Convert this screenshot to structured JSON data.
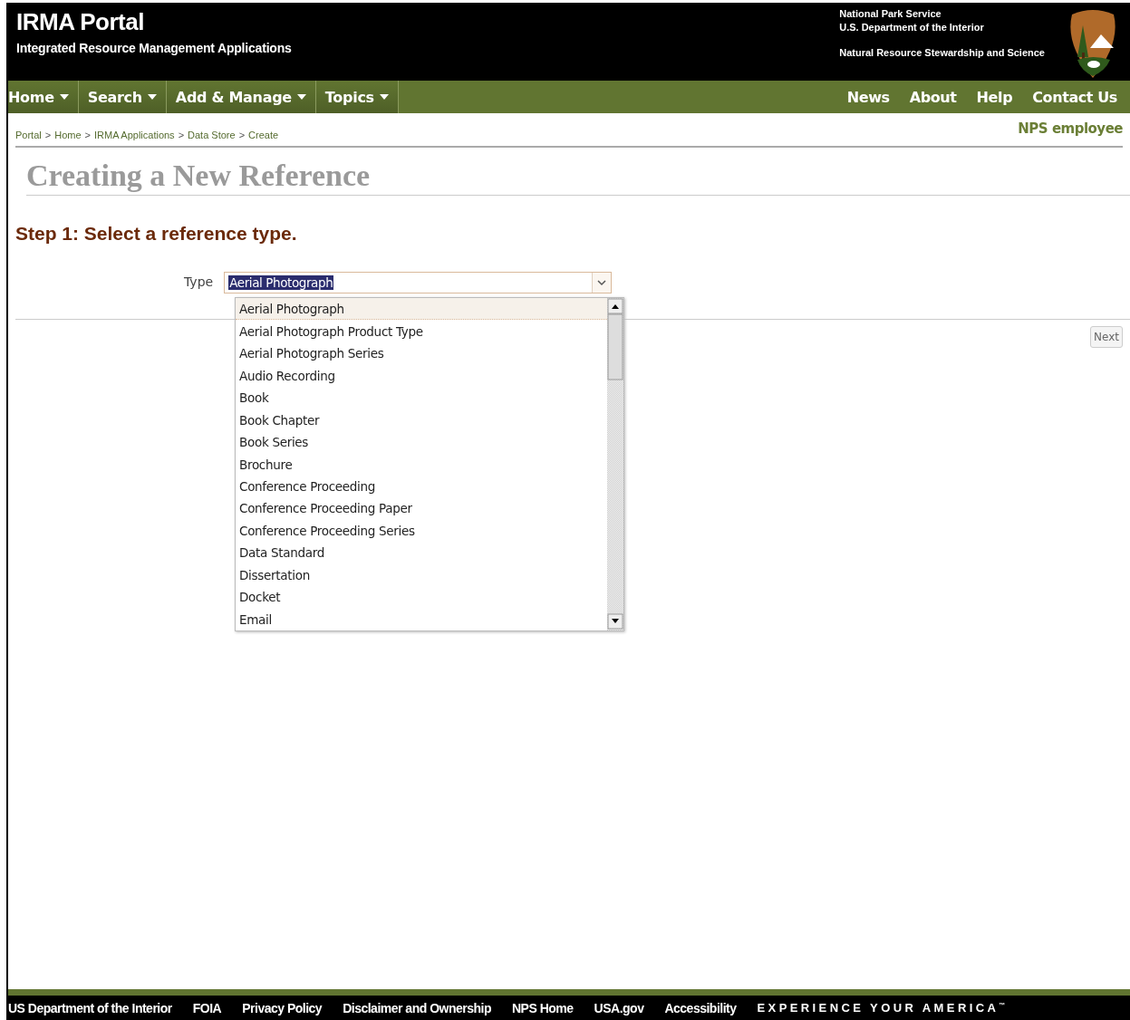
{
  "header": {
    "title": "IRMA Portal",
    "subtitle": "Integrated Resource Management Applications",
    "agency_lines": [
      "National Park Service",
      "U.S. Department of the Interior"
    ],
    "program": "Natural Resource Stewardship and Science"
  },
  "nav_left": [
    {
      "label": "Home",
      "dropdown": true
    },
    {
      "label": "Search",
      "dropdown": true
    },
    {
      "label": "Add & Manage",
      "dropdown": true
    },
    {
      "label": "Topics",
      "dropdown": true
    }
  ],
  "nav_right": [
    "News",
    "About",
    "Help",
    "Contact Us"
  ],
  "breadcrumb": [
    "Portal",
    "Home",
    "IRMA Applications",
    "Data Store",
    "Create"
  ],
  "breadcrumb_separator": ">",
  "user": "NPS employee",
  "page_title": "Creating a New Reference",
  "step_heading": "Step 1: Select a reference type.",
  "type_field": {
    "label": "Type",
    "value": "Aerial Photograph",
    "expanded": true
  },
  "options": [
    {
      "label": "Aerial Photograph",
      "selected": true
    },
    {
      "label": "Aerial Photograph Product Type",
      "selected": false
    },
    {
      "label": "Aerial Photograph Series",
      "selected": false
    },
    {
      "label": "Audio Recording",
      "selected": false
    },
    {
      "label": "Book",
      "selected": false
    },
    {
      "label": "Book Chapter",
      "selected": false
    },
    {
      "label": "Book Series",
      "selected": false
    },
    {
      "label": "Brochure",
      "selected": false
    },
    {
      "label": "Conference Proceeding",
      "selected": false
    },
    {
      "label": "Conference Proceeding Paper",
      "selected": false
    },
    {
      "label": "Conference Proceeding Series",
      "selected": false
    },
    {
      "label": "Data Standard",
      "selected": false
    },
    {
      "label": "Dissertation",
      "selected": false
    },
    {
      "label": "Docket",
      "selected": false
    },
    {
      "label": "Email",
      "selected": false
    }
  ],
  "next_button": "Next",
  "footer_links": [
    "US Department of the Interior",
    "FOIA",
    "Privacy Policy",
    "Disclaimer and Ownership",
    "NPS Home",
    "USA.gov",
    "Accessibility"
  ],
  "footer_tagline": "EXPERIENCE YOUR AMERICA",
  "footer_tagline_mark": "™"
}
